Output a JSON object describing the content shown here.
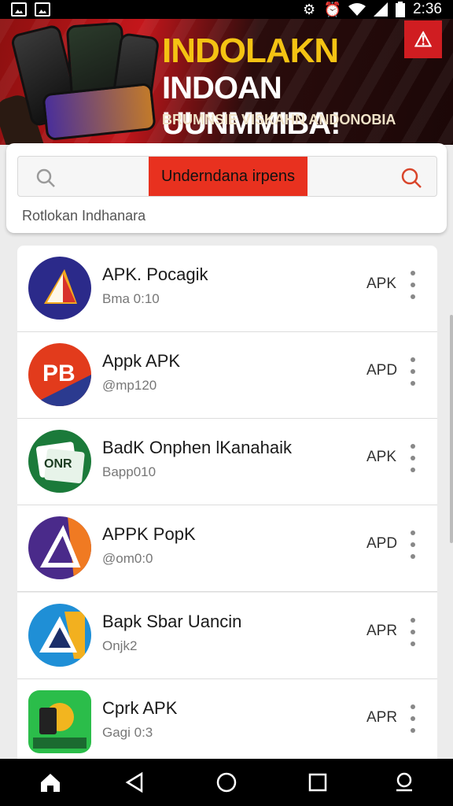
{
  "status_bar": {
    "time": "2:36"
  },
  "banner": {
    "title_line1": "INDOLAKN",
    "title_line2": "INDOAN UUNMMIBA!",
    "subtitle": "BRUMNSIE VISKAHN ANDONOBIA"
  },
  "search": {
    "chip_text": "Underndana irpens",
    "hint": "Rotlokan Indhanara"
  },
  "apps": [
    {
      "name": "APK. Pocagik",
      "meta": "Bma 0:10",
      "tag": "APK",
      "icon": "apk-triangle-icon",
      "color": "#2b2a8a"
    },
    {
      "name": "Appk APK",
      "meta": "@mp120",
      "tag": "APD",
      "icon": "apk-red-blue-icon",
      "color": "#e23b1c"
    },
    {
      "name": "BadK Onphen lKanahaik",
      "meta": "Bapp010",
      "tag": "APK",
      "icon": "card-green-icon",
      "color": "#1b7a3a"
    },
    {
      "name": "APPK PopK",
      "meta": "@om0:0",
      "tag": "APD",
      "icon": "apk-purple-icon",
      "color": "#4a2a8a"
    },
    {
      "name": "Bapk Sbar Uancin",
      "meta": "Onjk2",
      "tag": "APR",
      "icon": "apk-blue-icon",
      "color": "#1f8fd6"
    },
    {
      "name": "Cprk APK",
      "meta": "Gagi 0:3",
      "tag": "APR",
      "icon": "game-green-icon",
      "color": "#2bbd4a"
    }
  ],
  "nav": {
    "home": "home-icon",
    "back": "back-icon",
    "home_circle": "circle-home-icon",
    "recents": "recents-icon",
    "assistant": "assistant-icon"
  },
  "colors": {
    "accent_red": "#e8311f",
    "banner_yellow": "#f4c313",
    "nav_bg": "#000000"
  }
}
